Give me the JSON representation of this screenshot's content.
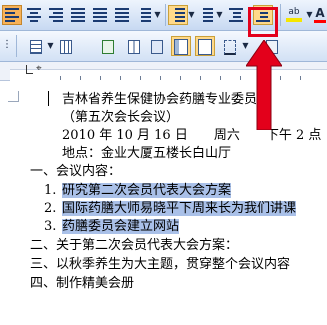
{
  "toolbar1": {
    "font_color_letter": "A",
    "highlight_label": "ab",
    "buttons": [
      "align-left",
      "center",
      "align-right",
      "justify",
      "distributed",
      "line-spacing",
      "numbering",
      "bullets",
      "decrease-indent",
      "increase-indent",
      "highlight",
      "font-color"
    ]
  },
  "toolbar2": {
    "buttons": [
      "table",
      "tables-borders",
      "insert-excel",
      "columns",
      "drawing",
      "document-map",
      "show-hide"
    ]
  },
  "document": {
    "title_line1": "吉林省养生保健协会药膳专业委员会",
    "title_line2": "（第五次会长会议）",
    "date_line": "2010 年 10 月 16 日　　周六　　下午 2 点",
    "place_line": "地点：金业大厦五楼长白山厅",
    "section1": "一、会议内容：",
    "item1_num": "1.",
    "item1_text": "研究第二次会员代表大会方案",
    "item2_num": "2.",
    "item2_text": "国际药膳大师易晓平下周来长为我们讲课",
    "item3_num": "3.",
    "item3_text": "药膳委员会建立网站",
    "section2": "二、关于第二次会员代表大会方案：",
    "section3": "三、以秋季养生为大主题，贯穿整个会议内容",
    "section4": "四、制作精美会册"
  },
  "colors": {
    "highlight": "#a9c0e8",
    "callout_red": "#e3001b",
    "font_color_bar": "#ff0000"
  }
}
